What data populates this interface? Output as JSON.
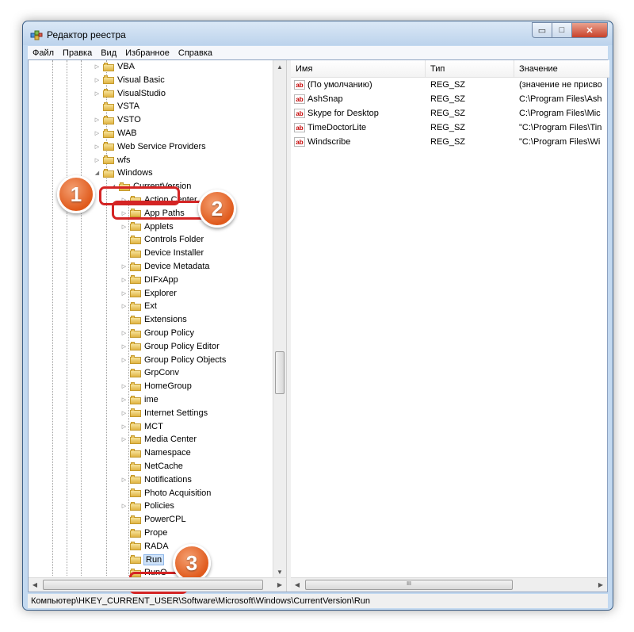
{
  "window": {
    "title": "Редактор реестра"
  },
  "menu": [
    "Файл",
    "Правка",
    "Вид",
    "Избранное",
    "Справка"
  ],
  "tree": {
    "items": [
      {
        "label": "VBA",
        "expander": "▷"
      },
      {
        "label": "Visual Basic",
        "expander": "▷"
      },
      {
        "label": "VisualStudio",
        "expander": "▷"
      },
      {
        "label": "VSTA",
        "expander": ""
      },
      {
        "label": "VSTO",
        "expander": "▷"
      },
      {
        "label": "WAB",
        "expander": "▷"
      },
      {
        "label": "Web Service Providers",
        "expander": "▷"
      },
      {
        "label": "wfs",
        "expander": "▷"
      },
      {
        "label": "Windows",
        "expander": "◢"
      },
      {
        "label": "CurrentVersion",
        "expander": "◢"
      },
      {
        "label": "Action Center",
        "expander": "▷"
      },
      {
        "label": "App Paths",
        "expander": "▷"
      },
      {
        "label": "Applets",
        "expander": "▷"
      },
      {
        "label": "Controls Folder",
        "expander": ""
      },
      {
        "label": "Device Installer",
        "expander": ""
      },
      {
        "label": "Device Metadata",
        "expander": "▷"
      },
      {
        "label": "DIFxApp",
        "expander": "▷"
      },
      {
        "label": "Explorer",
        "expander": "▷"
      },
      {
        "label": "Ext",
        "expander": "▷"
      },
      {
        "label": "Extensions",
        "expander": ""
      },
      {
        "label": "Group Policy",
        "expander": "▷"
      },
      {
        "label": "Group Policy Editor",
        "expander": "▷"
      },
      {
        "label": "Group Policy Objects",
        "expander": "▷"
      },
      {
        "label": "GrpConv",
        "expander": ""
      },
      {
        "label": "HomeGroup",
        "expander": "▷"
      },
      {
        "label": "ime",
        "expander": "▷"
      },
      {
        "label": "Internet Settings",
        "expander": "▷"
      },
      {
        "label": "MCT",
        "expander": "▷"
      },
      {
        "label": "Media Center",
        "expander": "▷"
      },
      {
        "label": "Namespace",
        "expander": ""
      },
      {
        "label": "NetCache",
        "expander": ""
      },
      {
        "label": "Notifications",
        "expander": "▷"
      },
      {
        "label": "Photo Acquisition",
        "expander": ""
      },
      {
        "label": "Policies",
        "expander": "▷"
      },
      {
        "label": "PowerCPL",
        "expander": ""
      },
      {
        "label": "Prope",
        "expander": ""
      },
      {
        "label": "RADA",
        "expander": ""
      },
      {
        "label": "Run",
        "expander": ""
      },
      {
        "label": "RunO",
        "expander": ""
      }
    ]
  },
  "badges": [
    "1",
    "2",
    "3"
  ],
  "list": {
    "columns": [
      "Имя",
      "Тип",
      "Значение"
    ],
    "rows": [
      {
        "name": "(По умолчанию)",
        "type": "REG_SZ",
        "value": "(значение не присво"
      },
      {
        "name": "AshSnap",
        "type": "REG_SZ",
        "value": "C:\\Program Files\\Ash"
      },
      {
        "name": "Skype for Desktop",
        "type": "REG_SZ",
        "value": "C:\\Program Files\\Mic"
      },
      {
        "name": "TimeDoctorLite",
        "type": "REG_SZ",
        "value": "\"C:\\Program Files\\Tin"
      },
      {
        "name": "Windscribe",
        "type": "REG_SZ",
        "value": "\"C:\\Program Files\\Wi"
      }
    ],
    "value_icon": "ab"
  },
  "scroll": {
    "h_thumb_glyph": "III"
  },
  "status": {
    "path": "Компьютер\\HKEY_CURRENT_USER\\Software\\Microsoft\\Windows\\CurrentVersion\\Run"
  },
  "colors": {
    "annotation_red": "#d42424",
    "badge_orange": "#e05a1c",
    "selection": "#cfe3fa"
  }
}
